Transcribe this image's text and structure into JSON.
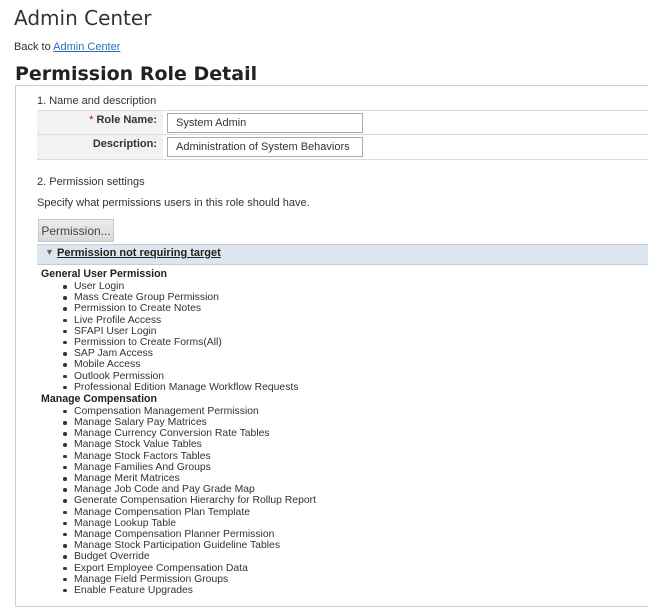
{
  "app_title": "Admin Center",
  "back": {
    "prefix": "Back to ",
    "link": "Admin Center"
  },
  "page_title": "Permission Role Detail",
  "section1": {
    "heading": "1. Name and description",
    "role_name_required": "*",
    "role_name_label": "Role Name:",
    "role_name_value": "System Admin",
    "description_label": "Description:",
    "description_value": "Administration of System Behaviors"
  },
  "section2": {
    "heading": "2. Permission settings",
    "hint": "Specify what permissions users in this role should have.",
    "permission_button": "Permission...",
    "collapse_label": "Permission not requiring target",
    "groups": [
      {
        "title": "General User Permission",
        "items": [
          "User Login",
          "Mass Create Group Permission",
          "Permission to Create Notes",
          "Live Profile Access",
          "SFAPI User Login",
          "Permission to Create Forms(All)",
          "SAP Jam Access",
          "Mobile Access",
          "Outlook Permission",
          "Professional Edition Manage Workflow Requests"
        ]
      },
      {
        "title": "Manage Compensation",
        "items": [
          "Compensation Management Permission",
          "Manage Salary Pay Matrices",
          "Manage Currency Conversion Rate Tables",
          "Manage Stock Value Tables",
          "Manage Stock Factors Tables",
          "Manage Families And Groups",
          "Manage Merit Matrices",
          "Manage Job Code and Pay Grade Map",
          "Generate Compensation Hierarchy for Rollup Report",
          "Manage Compensation Plan Template",
          "Manage Lookup Table",
          "Manage Compensation Planner Permission",
          "Manage Stock Participation Guideline Tables",
          "Budget Override",
          "Export Employee Compensation Data",
          "Manage Field Permission Groups",
          "Enable Feature Upgrades"
        ]
      }
    ]
  }
}
